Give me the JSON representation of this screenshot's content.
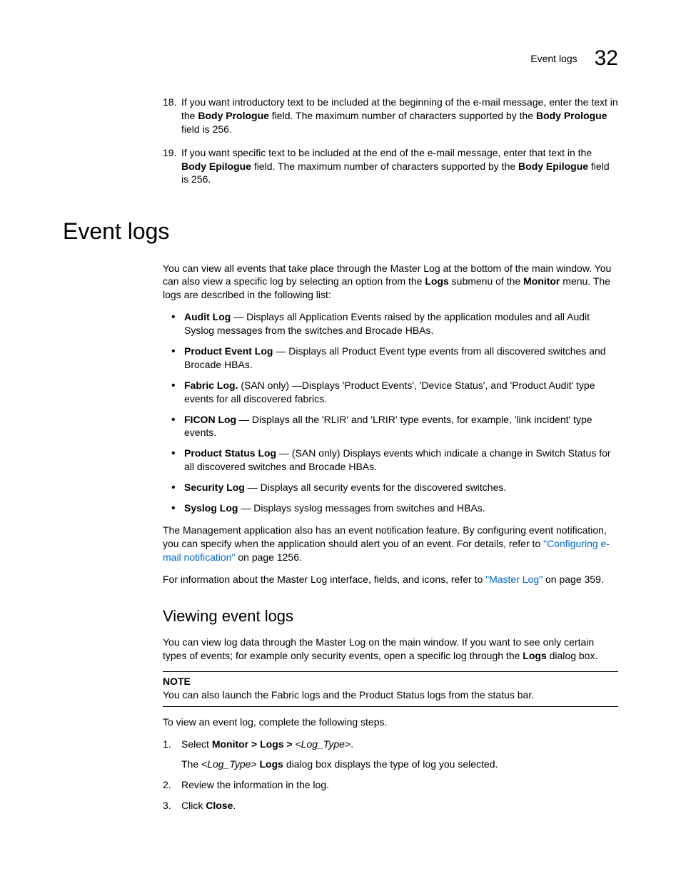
{
  "header": {
    "title": "Event logs",
    "chapter": "32"
  },
  "step18": {
    "num": "18.",
    "t1": "If you want introductory text to be included at the beginning of the e-mail message, enter the text in the ",
    "b1": "Body Prologue",
    "t2": " field. The maximum number of characters supported by the ",
    "b2": "Body Prologue",
    "t3": " field is 256."
  },
  "step19": {
    "num": "19.",
    "t1": "If you want specific text to be included at the end of the e-mail message, enter that text in the ",
    "b1": "Body Epilogue",
    "t2": " field. The maximum number of characters supported by the ",
    "b2": "Body Epilogue",
    "t3": " field is 256."
  },
  "h1": "Event logs",
  "intro": {
    "t1": "You can view all events that take place through the Master Log at the bottom of the main window. You can also view a specific log by selecting an option from the ",
    "b1": "Logs",
    "t2": " submenu of the ",
    "b2": "Monitor",
    "t3": " menu. The logs are described in the following list:"
  },
  "bullets": {
    "audit": {
      "b": "Audit Log",
      "t": " — Displays all Application Events raised by the application modules and all Audit Syslog messages from the switches and Brocade HBAs."
    },
    "product": {
      "b": "Product Event Log",
      "t": " — Displays all Product Event type events from all discovered switches and Brocade HBAs."
    },
    "fabric": {
      "b": "Fabric Log.",
      "t": " (SAN only) —Displays 'Product Events', 'Device Status', and 'Product Audit' type events for all discovered fabrics."
    },
    "ficon": {
      "b": "FICON Log",
      "t": " — Displays all the 'RLIR' and 'LRIR' type events, for example, 'link incident' type events."
    },
    "pstatus": {
      "b": "Product Status Log",
      "t": " — (SAN only) Displays events which indicate a change in Switch Status for all discovered switches and Brocade HBAs."
    },
    "security": {
      "b": "Security Log",
      "t": " — Displays all security events for the discovered switches."
    },
    "syslog": {
      "b": "Syslog Log",
      "t": " — Displays syslog messages from switches and HBAs."
    }
  },
  "para2": {
    "t1": "The Management application also has an event notification feature. By configuring event notification, you can specify when the application should alert you of an event. For details, refer to ",
    "link": "\"Configuring e-mail notification\"",
    "t2": " on page 1256."
  },
  "para3": {
    "t1": "For information about the Master Log interface, fields, and icons, refer to ",
    "link": "\"Master Log\"",
    "t2": " on page 359."
  },
  "h2": "Viewing event logs",
  "view_intro": {
    "t1": "You can view log data through the Master Log on the main window. If you want to see only certain types of events; for example only security events, open a specific log through the ",
    "b1": "Logs",
    "t2": " dialog box."
  },
  "note": {
    "label": "NOTE",
    "text": "You can also launch the Fabric logs and the Product Status logs from the status bar."
  },
  "steps_intro": "To view an event log, complete the following steps.",
  "s1": {
    "num": "1.",
    "t1": "Select ",
    "b1": "Monitor > Logs > ",
    "i1": "<Log_Type>",
    "t2": ".",
    "line2_t1": "The ",
    "line2_i1": "<Log_Type>",
    "line2_t2": " ",
    "line2_b1": "Logs",
    "line2_t3": " dialog box displays the type of log you selected."
  },
  "s2": {
    "num": "2.",
    "t": "Review the information in the log."
  },
  "s3": {
    "num": "3.",
    "t1": "Click ",
    "b1": "Close",
    "t2": "."
  }
}
